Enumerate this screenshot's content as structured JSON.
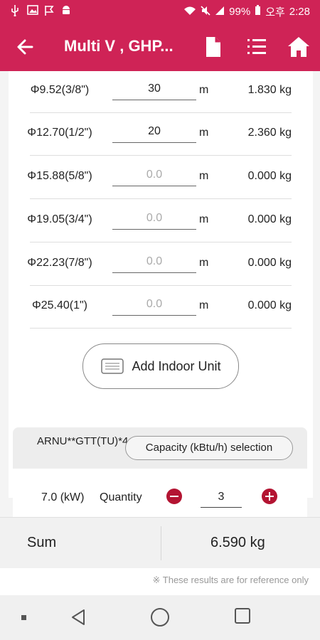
{
  "status_bar": {
    "battery": "99%",
    "ampm": "오후",
    "time": "2:28"
  },
  "app_bar": {
    "title": "Multi V , GHP...",
    "icons": [
      "back-arrow-icon",
      "document-icon",
      "list-icon",
      "home-icon"
    ]
  },
  "pipes": [
    {
      "size": "Φ9.52(3/8\")",
      "length": "30",
      "length_placeholder": "",
      "unit": "m",
      "weight": "1.830 kg"
    },
    {
      "size": "Φ12.70(1/2\")",
      "length": "20",
      "length_placeholder": "",
      "unit": "m",
      "weight": "2.360 kg"
    },
    {
      "size": "Φ15.88(5/8\")",
      "length": "",
      "length_placeholder": "0.0",
      "unit": "m",
      "weight": "0.000 kg"
    },
    {
      "size": "Φ19.05(3/4\")",
      "length": "",
      "length_placeholder": "0.0",
      "unit": "m",
      "weight": "0.000 kg"
    },
    {
      "size": "Φ22.23(7/8\")",
      "length": "",
      "length_placeholder": "0.0",
      "unit": "m",
      "weight": "0.000 kg"
    },
    {
      "size": "Φ25.40(1\")",
      "length": "",
      "length_placeholder": "0.0",
      "unit": "m",
      "weight": "0.000 kg"
    }
  ],
  "add_indoor_unit": {
    "label": "Add Indoor Unit"
  },
  "indoor_unit": {
    "model": "ARNU**GTT(TU)*4",
    "capacity_button": "Capacity (kBtu/h) selection",
    "capacity_value": "7.0 (kW)",
    "quantity_label": "Quantity",
    "quantity_value": "3"
  },
  "sum": {
    "label": "Sum",
    "value": "6.590 kg"
  },
  "note": "※ These results are for reference only",
  "colors": {
    "brand": "#cf2356",
    "stepper": "#b31432"
  }
}
